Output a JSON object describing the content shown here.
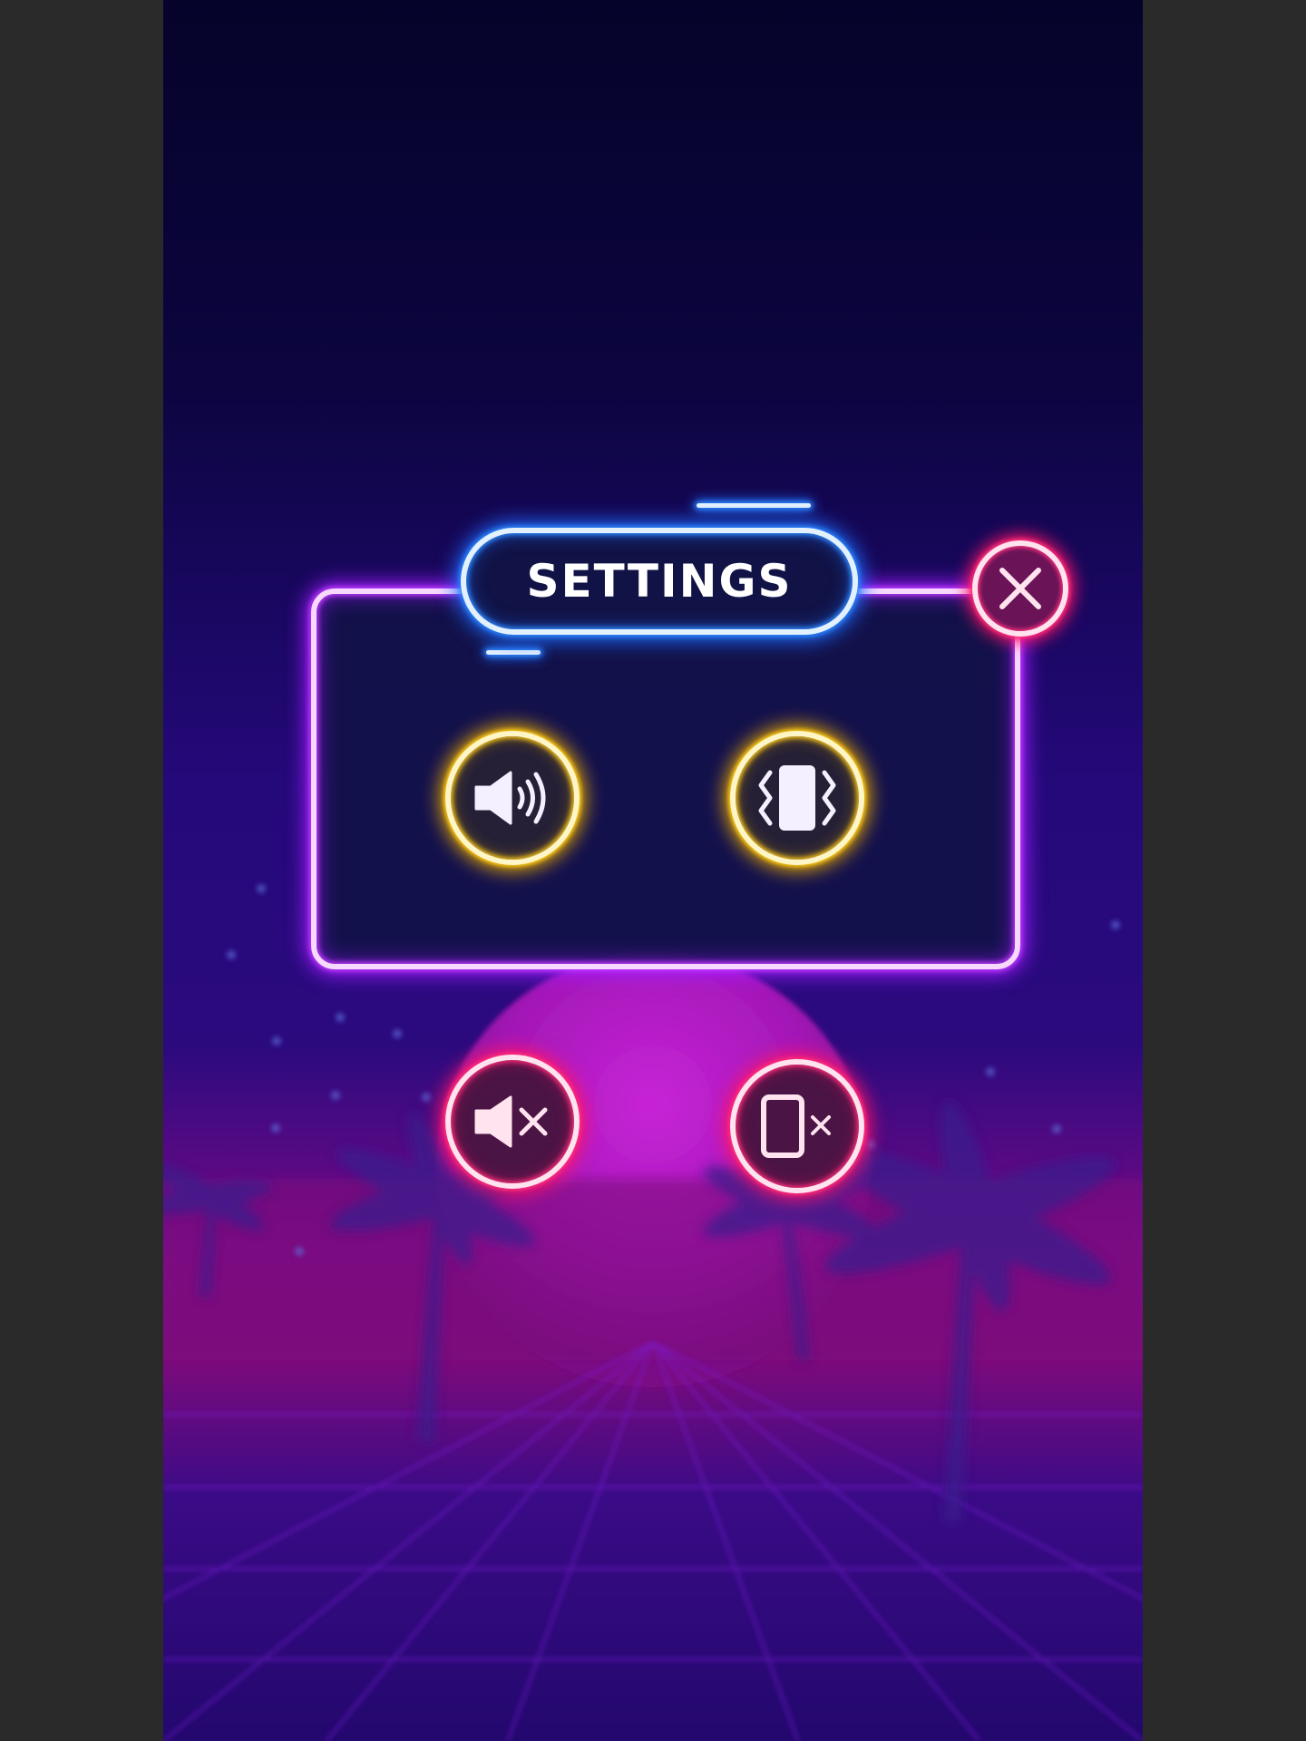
{
  "settings_dialog": {
    "title": "SETTINGS",
    "close_icon": "close-x-icon",
    "toggles": [
      {
        "name": "sound",
        "state": "on",
        "icon": "speaker-volume-icon",
        "color": "#ffcc1a"
      },
      {
        "name": "vibration",
        "state": "on",
        "icon": "phone-vibrate-icon",
        "color": "#ffcc1a"
      },
      {
        "name": "sound",
        "state": "off",
        "icon": "speaker-mute-icon",
        "color": "#ff2f7d"
      },
      {
        "name": "vibration",
        "state": "off",
        "icon": "phone-vibrate-off-icon",
        "color": "#ff2f7d"
      }
    ]
  },
  "theme": {
    "panel_neon": "#c23bff",
    "title_neon": "#2f8bff",
    "on_neon": "#ffcc1a",
    "off_neon": "#ff2f7d",
    "background_top": "#05032a",
    "background_bottom": "#2a0b7a"
  }
}
